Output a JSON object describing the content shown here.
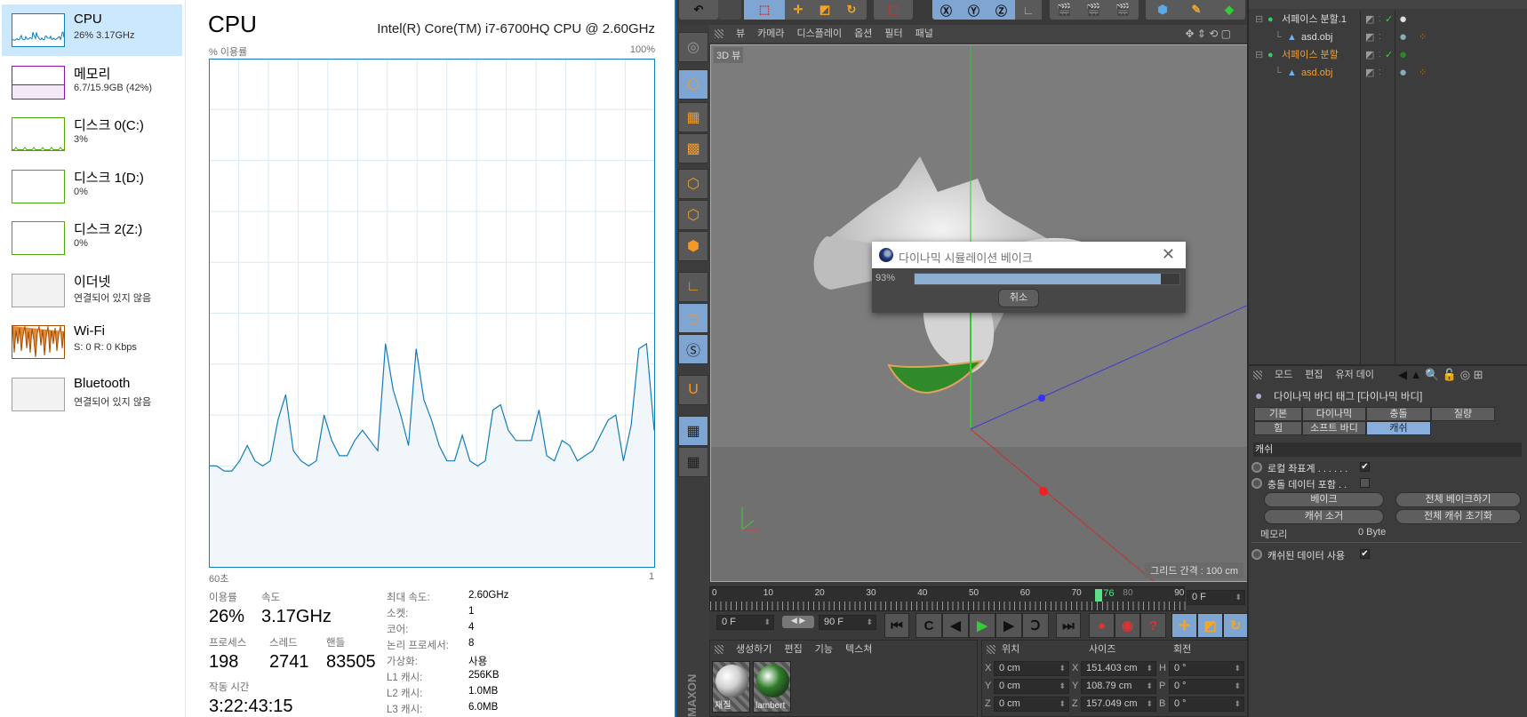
{
  "taskmanager": {
    "sidebar": [
      {
        "name": "CPU",
        "detail": "26% 3.17GHz",
        "color": "#117dbb",
        "selected": true
      },
      {
        "name": "메모리",
        "detail": "6.7/15.9GB (42%)",
        "color": "#8b12ae"
      },
      {
        "name": "디스크 0(C:)",
        "detail": "3%",
        "color": "#4da60c"
      },
      {
        "name": "디스크 1(D:)",
        "detail": "0%",
        "color": "#4da60c"
      },
      {
        "name": "디스크 2(Z:)",
        "detail": "0%",
        "color": "#4da60c"
      },
      {
        "name": "이더넷",
        "detail": "연결되어 있지 않음",
        "color": "#a0a0a0"
      },
      {
        "name": "Wi-Fi",
        "detail": "S: 0 R: 0 Kbps",
        "color": "#a74f01"
      },
      {
        "name": "Bluetooth",
        "detail": "연결되어 있지 않음",
        "color": "#a0a0a0"
      }
    ],
    "title": "CPU",
    "model": "Intel(R) Core(TM) i7-6700HQ CPU @ 2.60GHz",
    "stats": {
      "usage_label": "이용률",
      "usage": "26%",
      "speed_label": "속도",
      "speed": "3.17GHz",
      "processes_label": "프로세스",
      "processes": "198",
      "threads_label": "스레드",
      "threads": "2741",
      "handles_label": "핸들",
      "handles": "83505",
      "uptime_label": "작동 시간",
      "uptime": "3:22:43:15"
    },
    "specs": [
      {
        "k": "최대 속도:",
        "v": "2.60GHz"
      },
      {
        "k": "소켓:",
        "v": "1"
      },
      {
        "k": "코어:",
        "v": "4"
      },
      {
        "k": "논리 프로세서:",
        "v": "8"
      },
      {
        "k": "가상화:",
        "v": "사용"
      },
      {
        "k": "L1 캐시:",
        "v": "256KB"
      },
      {
        "k": "L2 캐시:",
        "v": "1.0MB"
      },
      {
        "k": "L3 캐시:",
        "v": "6.0MB"
      }
    ]
  },
  "chart_data": {
    "type": "area",
    "ylabel": "% 이용률",
    "ymax_label": "100%",
    "xlabel_left": "60초",
    "xlabel_right": "1",
    "xlim": [
      60,
      0
    ],
    "ylim": [
      0,
      100
    ],
    "grid": true,
    "color": "#117dbb",
    "values": [
      20,
      20,
      19,
      19,
      21,
      24,
      21,
      20,
      21,
      29,
      34,
      23,
      21,
      20,
      21,
      30,
      25,
      22,
      22,
      25,
      27,
      25,
      23,
      44,
      35,
      30,
      24,
      43,
      33,
      29,
      24,
      21,
      21,
      26,
      21,
      20,
      21,
      31,
      32,
      27,
      25,
      25,
      25,
      31,
      22,
      21,
      25,
      24,
      21,
      22,
      23,
      26,
      29,
      30,
      21,
      28,
      43,
      44,
      27
    ]
  },
  "c4d": {
    "viewport_menu": [
      "뷰",
      "카메라",
      "디스플레이",
      "옵션",
      "필터",
      "패널"
    ],
    "viewport_label": "3D 뷰",
    "grid_spacing": "그리드 간격 : 100 cm",
    "objects": [
      {
        "name": "서페이스 분할.1",
        "type": "subdivision",
        "highlight": false
      },
      {
        "name": "asd.obj",
        "type": "mesh",
        "highlight": false
      },
      {
        "name": "서페이스 분할",
        "type": "subdivision",
        "highlight": true
      },
      {
        "name": "asd.obj",
        "type": "mesh",
        "highlight": true
      }
    ],
    "attr_menu": [
      "모드",
      "편집",
      "유저 데이"
    ],
    "tag_title": "다이나믹 바디 태그 [다이나믹 바디]",
    "tabs": [
      "기본",
      "다이나믹",
      "충돌",
      "질량",
      "힘",
      "소프트 바디",
      "캐쉬"
    ],
    "active_tab": "캐쉬",
    "section": "캐쉬",
    "local_coords": "로컬 좌표계 . . . . . .",
    "local_coords_checked": true,
    "include_collision": "충돌 데이터 포함 . .",
    "include_collision_checked": false,
    "bake": "베이크",
    "bake_all": "전체 베이크하기",
    "clear_cache": "캐쉬 소거",
    "clear_all_cache": "전체 캐쉬 초기화",
    "memory_label": "메모리",
    "memory_value": "0 Byte",
    "use_cached": "캐쉬된 데이터 사용",
    "use_cached_checked": true,
    "timeline_ticks": [
      "0",
      "10",
      "20",
      "30",
      "40",
      "50",
      "60",
      "70",
      "90"
    ],
    "current_frame_marker": "76",
    "timeline_hidden_label": "80",
    "frame_field": "0 F",
    "start_frame": "0 F",
    "end_frame": "90 F",
    "material_menu": [
      "생성하기",
      "편집",
      "기능",
      "텍스쳐"
    ],
    "materials": [
      {
        "name": "재질",
        "color": "#d0d0d0"
      },
      {
        "name": "lambert",
        "color": "#2f7d2a"
      }
    ],
    "coord_headers": [
      "위치",
      "사이즈",
      "회전"
    ],
    "coords": [
      {
        "pl": "X",
        "p": "0 cm",
        "sl": "X",
        "s": "151.403 cm",
        "rl": "H",
        "r": "0 °"
      },
      {
        "pl": "Y",
        "p": "0 cm",
        "sl": "Y",
        "s": "108.79 cm",
        "rl": "P",
        "r": "0 °"
      },
      {
        "pl": "Z",
        "p": "0 cm",
        "sl": "Z",
        "s": "157.049 cm",
        "rl": "B",
        "r": "0 °"
      }
    ],
    "brand": "MAXON CINEMA 4D",
    "dialog": {
      "title": "다이나믹 시뮬레이션 베이크",
      "percent_label": "93%",
      "progress": 0.93,
      "cancel": "취소"
    }
  }
}
